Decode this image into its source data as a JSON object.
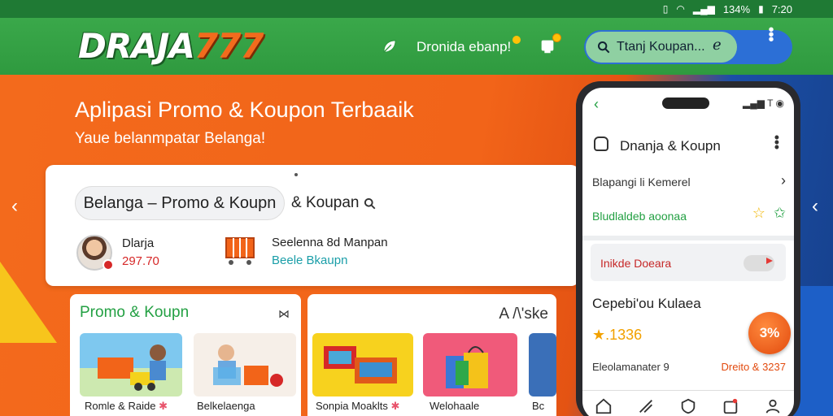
{
  "status_bar": {
    "battery": "134%",
    "time": "7:20"
  },
  "header": {
    "logo_main": "DRAJA",
    "logo_num": "777",
    "brand_link": "Dronida ebanp!",
    "search_placeholder": "Ttanj Koupan..."
  },
  "hero": {
    "title": "Aplipasi Promo & Koupon Terbaaik",
    "subtitle": "Yaue belanmpatar Belanga!"
  },
  "card": {
    "chip_label": "Belanga – Promo & Koupn",
    "chip2_label": "& Koupan",
    "profile_name": "Dlarja",
    "profile_value": "297.70",
    "basket_title": "Seelenna 8d Manpan",
    "basket_sub": "Beele Bkaupn"
  },
  "panel1": {
    "title": "Promo & Koupn",
    "items": [
      {
        "label": "Romle & Raide"
      },
      {
        "label": "Belkelaenga"
      }
    ]
  },
  "panel2": {
    "title": "A /\\'ske",
    "items": [
      {
        "label": "Sonpia Moaklts"
      },
      {
        "label": "Welohaale"
      },
      {
        "label": "Bc"
      }
    ]
  },
  "phone": {
    "signal": "T",
    "header": "Dnanja & Koupn",
    "row1": "Blapangi li Kemerel",
    "row2": "Bludlaldeb aoonaa",
    "toggle_label": "Inikde Doeara",
    "coupon_title": "Cepebi'ou Kulaea",
    "coupon_value": ".1336",
    "badge": "3%",
    "foot_left": "Eleolamanater 9",
    "foot_right": "Dreito & 3237"
  },
  "colors": {
    "green": "#2f9a3f",
    "orange": "#f26419",
    "blue": "#2c6fd6"
  }
}
